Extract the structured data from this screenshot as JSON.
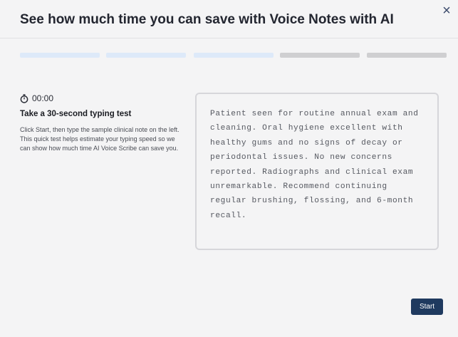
{
  "dialog": {
    "title": "See how much time you can save with Voice Notes with AI",
    "close_label": "×"
  },
  "progress": {
    "total_steps": 5,
    "completed_steps": 3,
    "colors": {
      "completed": "#dde9f9",
      "pending": "#cfcfd1"
    }
  },
  "test": {
    "timer": "00:00",
    "heading": "Take a 30-second typing test",
    "instructions": "Click Start, then type the sample clinical note on the left. This quick test helps estimate your typing speed so we can show how much time AI Voice Scribe can save you.",
    "sample_text": "Patient seen for routine annual exam and cleaning. Oral hygiene excellent with healthy gums and no signs of decay or periodontal issues. No new concerns reported. Radiographs and clinical exam unremarkable. Recommend continuing regular brushing, flossing, and 6-month recall."
  },
  "actions": {
    "start_label": "Start"
  },
  "colors": {
    "primary_button": "#1f3a5f",
    "close_icon": "#3b4a6b"
  }
}
